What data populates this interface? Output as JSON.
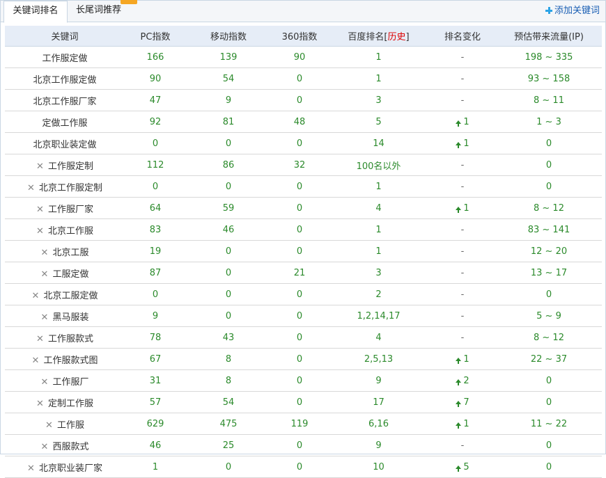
{
  "tabs": [
    {
      "label": "关键词排名",
      "active": true
    },
    {
      "label": "长尾词推荐",
      "active": false
    }
  ],
  "add_button_label": "添加关键词",
  "columns": {
    "keyword": "关键词",
    "pc": "PC指数",
    "mobile": "移动指数",
    "s360": "360指数",
    "baidu_prefix": "百度排名[",
    "baidu_link": "历史",
    "baidu_suffix": "]",
    "change": "排名变化",
    "traffic": "预估带来流量(IP)"
  },
  "rows": [
    {
      "keyword": "工作服定做",
      "deletable": false,
      "pc": "166",
      "mobile": "139",
      "s360": "90",
      "baidu": "1",
      "change": "-",
      "up": false,
      "traffic": "198 ~ 335"
    },
    {
      "keyword": "北京工作服定做",
      "deletable": false,
      "pc": "90",
      "mobile": "54",
      "s360": "0",
      "baidu": "1",
      "change": "-",
      "up": false,
      "traffic": "93 ~ 158"
    },
    {
      "keyword": "北京工作服厂家",
      "deletable": false,
      "pc": "47",
      "mobile": "9",
      "s360": "0",
      "baidu": "3",
      "change": "-",
      "up": false,
      "traffic": "8 ~ 11"
    },
    {
      "keyword": "定做工作服",
      "deletable": false,
      "pc": "92",
      "mobile": "81",
      "s360": "48",
      "baidu": "5",
      "change": "1",
      "up": true,
      "traffic": "1 ~ 3"
    },
    {
      "keyword": "北京职业装定做",
      "deletable": false,
      "pc": "0",
      "mobile": "0",
      "s360": "0",
      "baidu": "14",
      "change": "1",
      "up": true,
      "traffic": "0"
    },
    {
      "keyword": "工作服定制",
      "deletable": true,
      "pc": "112",
      "mobile": "86",
      "s360": "32",
      "baidu": "100名以外",
      "change": "-",
      "up": false,
      "traffic": "0"
    },
    {
      "keyword": "北京工作服定制",
      "deletable": true,
      "pc": "0",
      "mobile": "0",
      "s360": "0",
      "baidu": "1",
      "change": "-",
      "up": false,
      "traffic": "0"
    },
    {
      "keyword": "工作服厂家",
      "deletable": true,
      "pc": "64",
      "mobile": "59",
      "s360": "0",
      "baidu": "4",
      "change": "1",
      "up": true,
      "traffic": "8 ~ 12"
    },
    {
      "keyword": "北京工作服",
      "deletable": true,
      "pc": "83",
      "mobile": "46",
      "s360": "0",
      "baidu": "1",
      "change": "-",
      "up": false,
      "traffic": "83 ~ 141"
    },
    {
      "keyword": "北京工服",
      "deletable": true,
      "pc": "19",
      "mobile": "0",
      "s360": "0",
      "baidu": "1",
      "change": "-",
      "up": false,
      "traffic": "12 ~ 20"
    },
    {
      "keyword": "工服定做",
      "deletable": true,
      "pc": "87",
      "mobile": "0",
      "s360": "21",
      "baidu": "3",
      "change": "-",
      "up": false,
      "traffic": "13 ~ 17"
    },
    {
      "keyword": "北京工服定做",
      "deletable": true,
      "pc": "0",
      "mobile": "0",
      "s360": "0",
      "baidu": "2",
      "change": "-",
      "up": false,
      "traffic": "0"
    },
    {
      "keyword": "黑马服装",
      "deletable": true,
      "pc": "9",
      "mobile": "0",
      "s360": "0",
      "baidu": "1,2,14,17",
      "change": "-",
      "up": false,
      "traffic": "5 ~ 9"
    },
    {
      "keyword": "工作服款式",
      "deletable": true,
      "pc": "78",
      "mobile": "43",
      "s360": "0",
      "baidu": "4",
      "change": "-",
      "up": false,
      "traffic": "8 ~ 12"
    },
    {
      "keyword": "工作服款式图",
      "deletable": true,
      "pc": "67",
      "mobile": "8",
      "s360": "0",
      "baidu": "2,5,13",
      "change": "1",
      "up": true,
      "traffic": "22 ~ 37"
    },
    {
      "keyword": "工作服厂",
      "deletable": true,
      "pc": "31",
      "mobile": "8",
      "s360": "0",
      "baidu": "9",
      "change": "2",
      "up": true,
      "traffic": "0"
    },
    {
      "keyword": "定制工作服",
      "deletable": true,
      "pc": "57",
      "mobile": "54",
      "s360": "0",
      "baidu": "17",
      "change": "7",
      "up": true,
      "traffic": "0"
    },
    {
      "keyword": "工作服",
      "deletable": true,
      "pc": "629",
      "mobile": "475",
      "s360": "119",
      "baidu": "6,16",
      "change": "1",
      "up": true,
      "traffic": "11 ~ 22"
    },
    {
      "keyword": "西服款式",
      "deletable": true,
      "pc": "46",
      "mobile": "25",
      "s360": "0",
      "baidu": "9",
      "change": "-",
      "up": false,
      "traffic": "0"
    },
    {
      "keyword": "北京职业装厂家",
      "deletable": true,
      "pc": "1",
      "mobile": "0",
      "s360": "0",
      "baidu": "10",
      "change": "5",
      "up": true,
      "traffic": "0"
    }
  ],
  "icons": {
    "delete": "close-x-icon",
    "up": "arrow-up-icon",
    "add": "plus-icon"
  },
  "colors": {
    "value_green": "#2b8a2b",
    "history_red": "#dd0000",
    "header_bg": "#e6edf7",
    "link_blue": "#1a5fb4"
  }
}
